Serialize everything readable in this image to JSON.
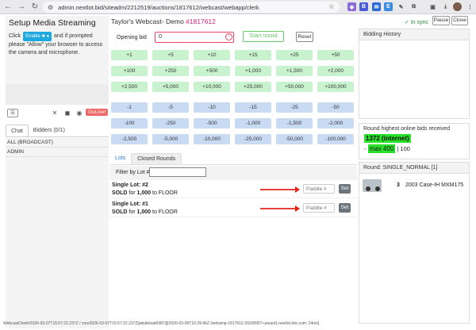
{
  "browser": {
    "url": "admin.nextlot.bid/siteadm/2212519/auctions/1817612/webcast/webapp/clerk"
  },
  "streaming": {
    "title": "Setup Media Streaming",
    "text_before": "Click",
    "enable_label": "Enable",
    "text_after": "and if prompted please \"Allow\" your browser to access the camera and microphone.",
    "golive_label": "GoLive!"
  },
  "chat": {
    "tabs": [
      "Chat",
      "Bidders (0/1)"
    ],
    "rows": [
      "ALL (BROADCAST)",
      "ADMIN"
    ]
  },
  "webcast": {
    "title": "Taylor's Webcast- Demo",
    "id": "#1817612",
    "opening_bid_label": "Opening bid",
    "opening_bid_value": "0",
    "start_round_label": "Start round",
    "reset_label": "Reset"
  },
  "increments": {
    "positive": [
      "+1",
      "+5",
      "+10",
      "+15",
      "+25",
      "+50",
      "+100",
      "+250",
      "+500",
      "+1,000",
      "+1,500",
      "+2,000",
      "+2,500",
      "+5,000",
      "+10,000",
      "+25,000",
      "+50,000",
      "+100,000"
    ],
    "negative": [
      "-1",
      "-5",
      "-10",
      "-15",
      "-25",
      "-50",
      "-100",
      "-250",
      "-500",
      "-1,000",
      "-1,500",
      "-2,000",
      "-2,500",
      "-5,000",
      "-10,000",
      "-25,000",
      "-50,000",
      "-100,000"
    ]
  },
  "lots": {
    "tabs": [
      "Lots",
      "Closed Rounds"
    ],
    "filter_label": "Filter by Lot #",
    "paddle_placeholder": "Paddle #",
    "set_label": "Set",
    "rows": [
      {
        "name": "Single Lot: #2",
        "sold": "SOLD",
        "for": "for",
        "amount": "1,000",
        "to": "to FLOOR"
      },
      {
        "name": "Single Lot: #1",
        "sold": "SOLD",
        "for": "for",
        "amount": "1,000",
        "to": "to FLOOR"
      }
    ]
  },
  "right": {
    "sync_label": "✓ In sync",
    "pause_label": "Pause",
    "close_label": "Close",
    "bidding_history_title": "Bidding History",
    "highest_title": "Round highest online bids received",
    "highest_bid": "1372 (internet)",
    "max_prefix": "-",
    "max_label": "max 400",
    "max_suffix": "| 100",
    "round_title": "Round: SINGLE_NORMAL [1]",
    "round_item_num": "3",
    "round_item_name": "2003 Case-IH MXM175"
  },
  "status_bar": "WebcastClerk#2026-03-07T15:57:22.237Z / core2026-03-07T15:57:22.237Z[wbafebab6987@2026-03-05T16:29:46Z /webamp-1817612-20200907-useast1.nextlot-live.com: 24ms]"
}
